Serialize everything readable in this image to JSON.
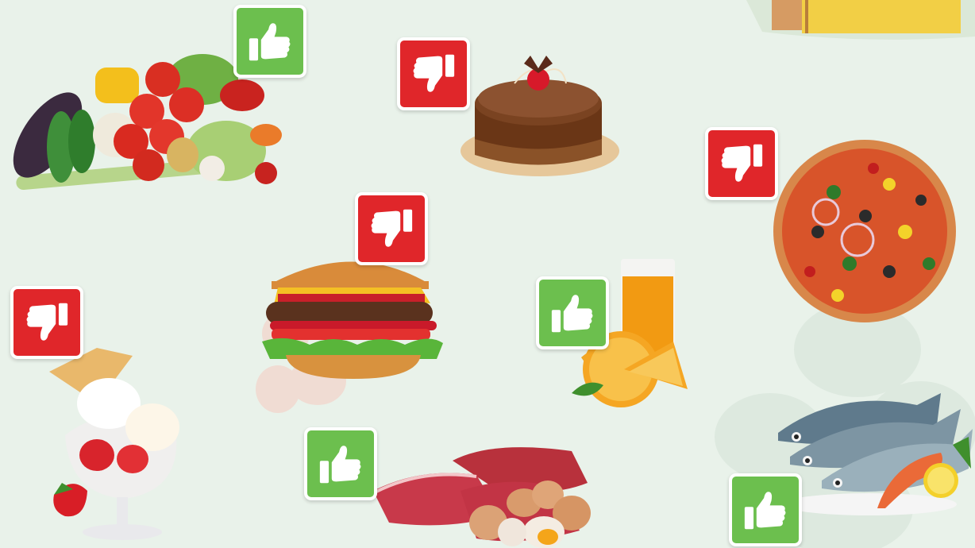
{
  "theme": {
    "background": "#e9f2ea",
    "like_color": "#6cbf4e",
    "dislike_color": "#e0262a"
  },
  "foods": [
    {
      "name": "vegetables",
      "verdict": "like",
      "icon": "thumbs-up-icon"
    },
    {
      "name": "chocolate-cake",
      "verdict": "dislike",
      "icon": "thumbs-down-icon"
    },
    {
      "name": "pizza",
      "verdict": "dislike",
      "icon": "thumbs-down-icon"
    },
    {
      "name": "hamburger",
      "verdict": "dislike",
      "icon": "thumbs-down-icon"
    },
    {
      "name": "orange-juice",
      "verdict": "like",
      "icon": "thumbs-up-icon"
    },
    {
      "name": "ice-cream-sundae",
      "verdict": "dislike",
      "icon": "thumbs-down-icon"
    },
    {
      "name": "meat-and-eggs",
      "verdict": "like",
      "icon": "thumbs-up-icon"
    },
    {
      "name": "fish-and-seafood",
      "verdict": "like",
      "icon": "thumbs-up-icon"
    },
    {
      "name": "cheese",
      "verdict": "",
      "icon": ""
    }
  ]
}
